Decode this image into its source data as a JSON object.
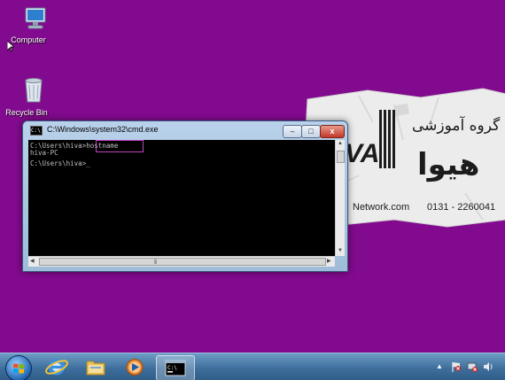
{
  "desktop": {
    "icons": [
      {
        "label": "Computer"
      },
      {
        "label": "Recycle Bin"
      }
    ]
  },
  "poster": {
    "title": "گروه آموزشی",
    "brand": "هیوا",
    "website": "Network.com",
    "phone": "0131 - 2260041",
    "logo_fragment": "VA"
  },
  "cmd_window": {
    "title": "C:\\Windows\\system32\\cmd.exe",
    "icon_text": "C:\\",
    "buttons": {
      "minimize": "–",
      "maximize": "□",
      "close": "x"
    },
    "console_lines": [
      "C:\\Users\\hiva>hostname",
      "hiva-PC",
      "",
      "C:\\Users\\hiva>_"
    ],
    "highlighted_command": "hostname"
  },
  "taskbar": {
    "buttons": [
      "start-button",
      "internet-explorer",
      "windows-explorer",
      "media-player",
      "command-prompt"
    ],
    "tray_arrow": "▲"
  },
  "colors": {
    "desktop_bg": "#820a8e",
    "console_bg": "#000000",
    "console_text": "#c0c0c0",
    "highlight_border": "#c040c0",
    "taskbar": "#3e6e9c"
  }
}
